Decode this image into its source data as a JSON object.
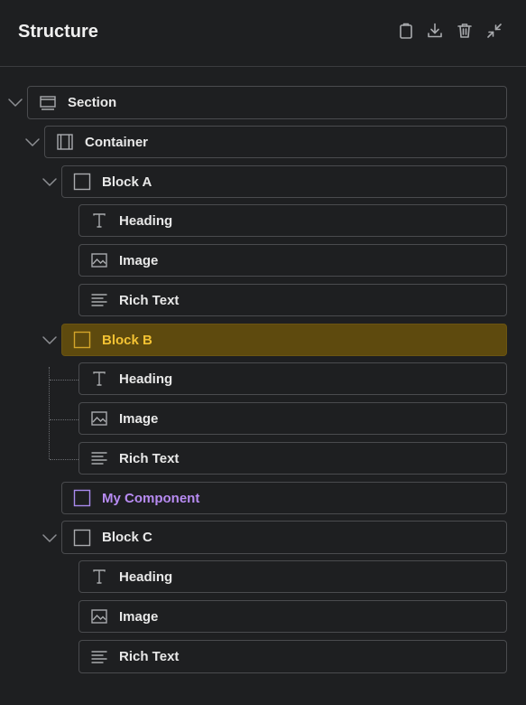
{
  "panel": {
    "title": "Structure",
    "toolbar": [
      {
        "icon": "clipboard-icon",
        "label": ""
      },
      {
        "icon": "download-icon",
        "label": ""
      },
      {
        "icon": "trash-icon",
        "label": ""
      },
      {
        "icon": "collapse-icon",
        "label": ""
      }
    ]
  },
  "tree": {
    "section": "Section",
    "container": "Container",
    "block_a": {
      "label": "Block A",
      "children": [
        "Heading",
        "Image",
        "Rich Text"
      ]
    },
    "block_b": {
      "label": "Block B",
      "children": [
        "Heading",
        "Image",
        "Rich Text"
      ]
    },
    "my_component": "My Component",
    "block_c": {
      "label": "Block C",
      "children": [
        "Heading",
        "Image",
        "Rich Text"
      ]
    }
  },
  "colors": {
    "background": "#1e1f21",
    "selected_bg": "#5e4a0e",
    "selected_text": "#f3c233",
    "component_text": "#b78bf2"
  }
}
